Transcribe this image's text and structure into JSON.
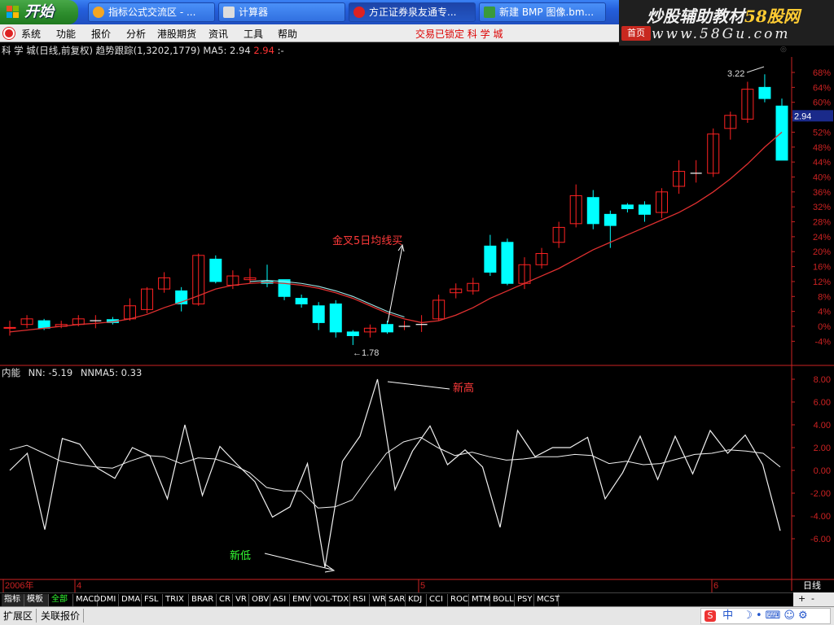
{
  "taskbar": {
    "start_label": "开始",
    "tasks": [
      {
        "label": "指标公式交流区 - ...",
        "icon": "forum-icon"
      },
      {
        "label": "计算器",
        "icon": "calculator-icon"
      },
      {
        "label": "方正证券泉友通专...",
        "icon": "stock-app-icon"
      },
      {
        "label": "新建 BMP 图像.bm...",
        "icon": "paint-icon"
      }
    ]
  },
  "watermark": {
    "line1_a": "炒股辅助教材",
    "line1_b": "58股网",
    "line2": "www.58Gu.com"
  },
  "menu": {
    "items": [
      "系统",
      "功能",
      "报价",
      "分析",
      "港股期货",
      "资讯",
      "工具",
      "帮助"
    ],
    "lock_status": "交易已锁定  科 学 城",
    "home_button": "首页"
  },
  "chart_info": {
    "stock": "科 学 城(日线,前复权)",
    "indicator": "趋势跟踪(1,3202,1779)",
    "ma_label": "MA5: 2.94",
    "ma_value": "2.94",
    "tail": ":-"
  },
  "indicator_info": {
    "name": "内能",
    "nn": "NN: -5.19",
    "nnma": "NNMA5: 0.33"
  },
  "annotations": {
    "golden_cross": "金叉5日均线买",
    "new_high": "新高",
    "new_low": "新低",
    "peak_price": "3.22",
    "low_price": "1.78",
    "last_price": "2.94"
  },
  "colors": {
    "up": "#ff2222",
    "down": "#00ffff",
    "ma": "#e03030",
    "text": "#e0e0e0",
    "axis": "#cc2222"
  },
  "chart_data": [
    {
      "type": "candlestick",
      "title": "科 学 城(日线,前复权)",
      "y_axis_labels": [
        "68%",
        "64%",
        "60%",
        "56%",
        "52%",
        "48%",
        "44%",
        "40%",
        "36%",
        "32%",
        "28%",
        "24%",
        "20%",
        "16%",
        "12%",
        "8%",
        "4%",
        "0%",
        "-4%"
      ],
      "ylim": [
        -4,
        68
      ],
      "x_axis_labels": [
        "2006年",
        "4",
        "5",
        "6"
      ],
      "candles": [
        {
          "o": -0.5,
          "c": -0.3,
          "h": 1.5,
          "l": -2.5
        },
        {
          "o": 0.5,
          "c": 2.0,
          "h": 3.0,
          "l": -0.5
        },
        {
          "o": 1.5,
          "c": -0.5,
          "h": 2.0,
          "l": -1.0
        },
        {
          "o": 0.0,
          "c": 0.5,
          "h": 1.5,
          "l": -0.5
        },
        {
          "o": 0.5,
          "c": 2.0,
          "h": 3.0,
          "l": 0.0
        },
        {
          "o": 1.5,
          "c": 1.5,
          "h": 3.0,
          "l": -0.5
        },
        {
          "o": 1.8,
          "c": 1.0,
          "h": 2.5,
          "l": 0.5
        },
        {
          "o": 2.0,
          "c": 5.5,
          "h": 7.5,
          "l": 1.5
        },
        {
          "o": 4.5,
          "c": 10.0,
          "h": 10.5,
          "l": 3.5
        },
        {
          "o": 10.0,
          "c": 13.0,
          "h": 14.5,
          "l": 9.0
        },
        {
          "o": 9.5,
          "c": 6.0,
          "h": 10.5,
          "l": 4.0
        },
        {
          "o": 6.0,
          "c": 19.0,
          "h": 19.5,
          "l": 5.5
        },
        {
          "o": 18.0,
          "c": 12.0,
          "h": 19.0,
          "l": 11.5
        },
        {
          "o": 11.0,
          "c": 13.5,
          "h": 15.0,
          "l": 10.0
        },
        {
          "o": 12.5,
          "c": 13.0,
          "h": 15.5,
          "l": 11.5
        },
        {
          "o": 12.0,
          "c": 11.5,
          "h": 16.5,
          "l": 10.5
        },
        {
          "o": 12.5,
          "c": 8.0,
          "h": 12.5,
          "l": 7.0
        },
        {
          "o": 7.5,
          "c": 6.0,
          "h": 8.5,
          "l": 5.0
        },
        {
          "o": 5.5,
          "c": 1.0,
          "h": 6.5,
          "l": -1.0
        },
        {
          "o": 6.0,
          "c": -1.5,
          "h": 7.0,
          "l": -3.0
        },
        {
          "o": -1.5,
          "c": -2.5,
          "h": -1.0,
          "l": -5.0
        },
        {
          "o": -1.5,
          "c": -0.5,
          "h": 0.5,
          "l": -3.0
        },
        {
          "o": 0.5,
          "c": -1.5,
          "h": 1.5,
          "l": -2.0
        },
        {
          "o": 0.0,
          "c": 0.0,
          "h": 1.5,
          "l": -1.0
        },
        {
          "o": 0.5,
          "c": 0.5,
          "h": 3.0,
          "l": -1.5
        },
        {
          "o": 2.0,
          "c": 7.0,
          "h": 8.5,
          "l": 1.5
        },
        {
          "o": 9.0,
          "c": 10.0,
          "h": 11.5,
          "l": 7.5
        },
        {
          "o": 9.5,
          "c": 11.5,
          "h": 13.0,
          "l": 8.5
        },
        {
          "o": 21.5,
          "c": 14.5,
          "h": 24.5,
          "l": 13.5
        },
        {
          "o": 22.5,
          "c": 11.5,
          "h": 23.5,
          "l": 11.0
        },
        {
          "o": 11.5,
          "c": 16.5,
          "h": 18.5,
          "l": 10.0
        },
        {
          "o": 16.5,
          "c": 19.5,
          "h": 21.0,
          "l": 15.5
        },
        {
          "o": 22.5,
          "c": 26.5,
          "h": 28.0,
          "l": 21.0
        },
        {
          "o": 27.5,
          "c": 35.0,
          "h": 38.0,
          "l": 26.5
        },
        {
          "o": 34.5,
          "c": 27.5,
          "h": 36.5,
          "l": 26.0
        },
        {
          "o": 30.0,
          "c": 27.0,
          "h": 31.0,
          "l": 21.0
        },
        {
          "o": 32.5,
          "c": 31.5,
          "h": 33.0,
          "l": 30.5
        },
        {
          "o": 32.5,
          "c": 30.0,
          "h": 33.5,
          "l": 28.0
        },
        {
          "o": 30.5,
          "c": 36.0,
          "h": 37.0,
          "l": 29.0
        },
        {
          "o": 37.5,
          "c": 41.5,
          "h": 44.5,
          "l": 35.5
        },
        {
          "o": 41.0,
          "c": 41.0,
          "h": 44.5,
          "l": 38.5
        },
        {
          "o": 41.0,
          "c": 51.5,
          "h": 53.0,
          "l": 40.0
        },
        {
          "o": 53.0,
          "c": 56.5,
          "h": 57.5,
          "l": 50.0
        },
        {
          "o": 55.5,
          "c": 63.5,
          "h": 65.5,
          "l": 54.5
        },
        {
          "o": 64.0,
          "c": 61.0,
          "h": 67.5,
          "l": 60.0
        },
        {
          "o": 59.0,
          "c": 44.5,
          "h": 61.0,
          "l": 44.5
        }
      ],
      "ma5": [
        -1.5,
        -1.0,
        -0.5,
        0.0,
        0.5,
        0.8,
        1.2,
        2.0,
        3.2,
        5.0,
        6.5,
        8.2,
        10.0,
        11.0,
        11.5,
        11.8,
        11.5,
        11.0,
        10.2,
        9.0,
        7.5,
        5.5,
        3.5,
        2.0,
        1.0,
        1.5,
        3.0,
        5.0,
        7.5,
        9.5,
        11.5,
        13.5,
        15.5,
        18.0,
        20.5,
        22.5,
        24.5,
        26.5,
        28.5,
        30.5,
        33.0,
        36.0,
        39.5,
        43.5,
        48.0,
        52.0
      ],
      "ma5_early": [
        12.0,
        11.5,
        10.5
      ]
    },
    {
      "type": "line",
      "title": "内能",
      "y_axis_labels": [
        "8.00",
        "6.00",
        "4.00",
        "2.00",
        "0.00",
        "-2.00",
        "-4.00",
        "-6.00"
      ],
      "ylim": [
        -8,
        9
      ],
      "series": [
        {
          "name": "NN",
          "values": [
            0.0,
            1.5,
            -5.2,
            2.8,
            2.3,
            0.2,
            -0.7,
            2.0,
            1.3,
            -2.5,
            4.0,
            -2.2,
            2.1,
            0.5,
            -1.0,
            -4.1,
            -3.2,
            0.6,
            -8.5,
            0.8,
            3.0,
            8.0,
            -1.7,
            1.7,
            3.9,
            0.5,
            1.8,
            0.3,
            -5.0,
            3.5,
            1.2,
            2.0,
            2.0,
            2.9,
            -2.5,
            -0.2,
            3.0,
            -0.8,
            3.0,
            -0.3,
            3.5,
            1.5,
            3.1,
            0.5,
            -5.3
          ]
        },
        {
          "name": "NNMA5",
          "values": [
            1.8,
            2.2,
            1.5,
            0.8,
            0.5,
            0.3,
            0.2,
            0.8,
            1.3,
            1.2,
            0.6,
            1.1,
            1.0,
            0.5,
            -0.2,
            -1.5,
            -1.8,
            -1.8,
            -3.3,
            -3.2,
            -2.6,
            -0.5,
            1.5,
            2.5,
            2.9,
            2.0,
            1.3,
            1.6,
            1.2,
            0.9,
            1.0,
            1.2,
            1.2,
            1.4,
            1.3,
            0.6,
            0.8,
            0.5,
            0.6,
            1.0,
            1.4,
            1.5,
            1.8,
            1.7,
            1.5,
            0.3
          ]
        }
      ]
    }
  ],
  "tabs": [
    "指标",
    "模板",
    "全部",
    "MACD",
    "DMI",
    "DMA",
    "FSL",
    "TRIX",
    "BRAR",
    "CR",
    "VR",
    "OBV",
    "ASI",
    "EMV",
    "VOL-TDX",
    "RSI",
    "WR",
    "SAR",
    "KDJ",
    "CCI",
    "ROC",
    "MTM",
    "BOLL",
    "PSY",
    "MCST"
  ],
  "tab_nav": [
    "+",
    "-"
  ],
  "period_label": "日线",
  "status": {
    "expand": "扩展区",
    "related": "关联报价",
    "ime": "中"
  }
}
